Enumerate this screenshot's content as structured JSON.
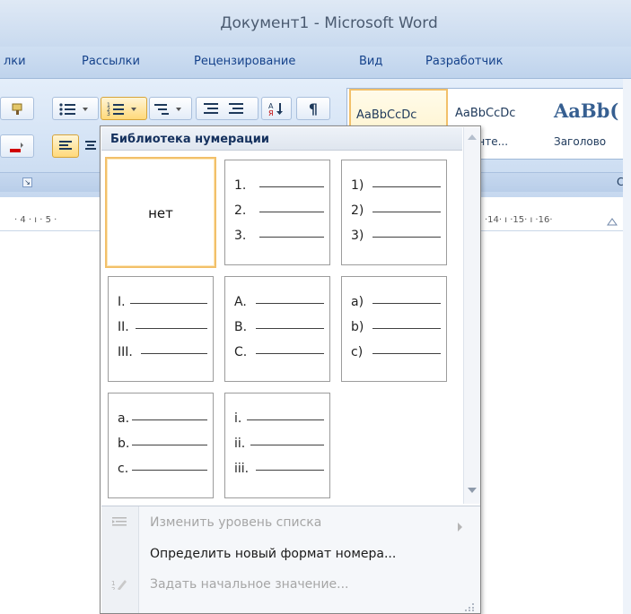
{
  "window": {
    "title": "Документ1 - Microsoft Word"
  },
  "tabs": [
    {
      "label": "лки"
    },
    {
      "label": "Рассылки"
    },
    {
      "label": "Рецензирование"
    },
    {
      "label": "Вид"
    },
    {
      "label": "Разработчик"
    }
  ],
  "ribbon": {
    "styles": [
      {
        "sample": "AaBbCcDc",
        "name": ""
      },
      {
        "sample": "AaBbCcDc",
        "name": "ез инте..."
      },
      {
        "sample": "AaBb(",
        "name": "Заголово"
      }
    ],
    "group_label_fragment": "С"
  },
  "ruler": {
    "left_text": "· 4 · ı · 5 ·",
    "right_text": "·14· ı ·15· ı ·16·"
  },
  "numbering_menu": {
    "header": "Библиотека нумерации",
    "cells": [
      {
        "type": "none",
        "text": "нет"
      },
      {
        "type": "list",
        "labels": [
          "1.",
          "2.",
          "3."
        ]
      },
      {
        "type": "list",
        "labels": [
          "1)",
          "2)",
          "3)"
        ]
      },
      {
        "type": "list",
        "labels": [
          "I.",
          "II.",
          "III."
        ]
      },
      {
        "type": "list",
        "labels": [
          "A.",
          "B.",
          "C."
        ]
      },
      {
        "type": "list",
        "labels": [
          "a)",
          "b)",
          "c)"
        ]
      },
      {
        "type": "list",
        "labels": [
          "a.",
          "b.",
          "c."
        ]
      },
      {
        "type": "list",
        "labels": [
          "i.",
          "ii.",
          "iii."
        ]
      }
    ],
    "items": [
      {
        "label": "Изменить уровень списка",
        "enabled": false,
        "has_submenu": true
      },
      {
        "label": "Определить новый формат номера...",
        "enabled": true,
        "has_submenu": false
      },
      {
        "label": "Задать начальное значение...",
        "enabled": false,
        "has_submenu": false
      }
    ]
  }
}
